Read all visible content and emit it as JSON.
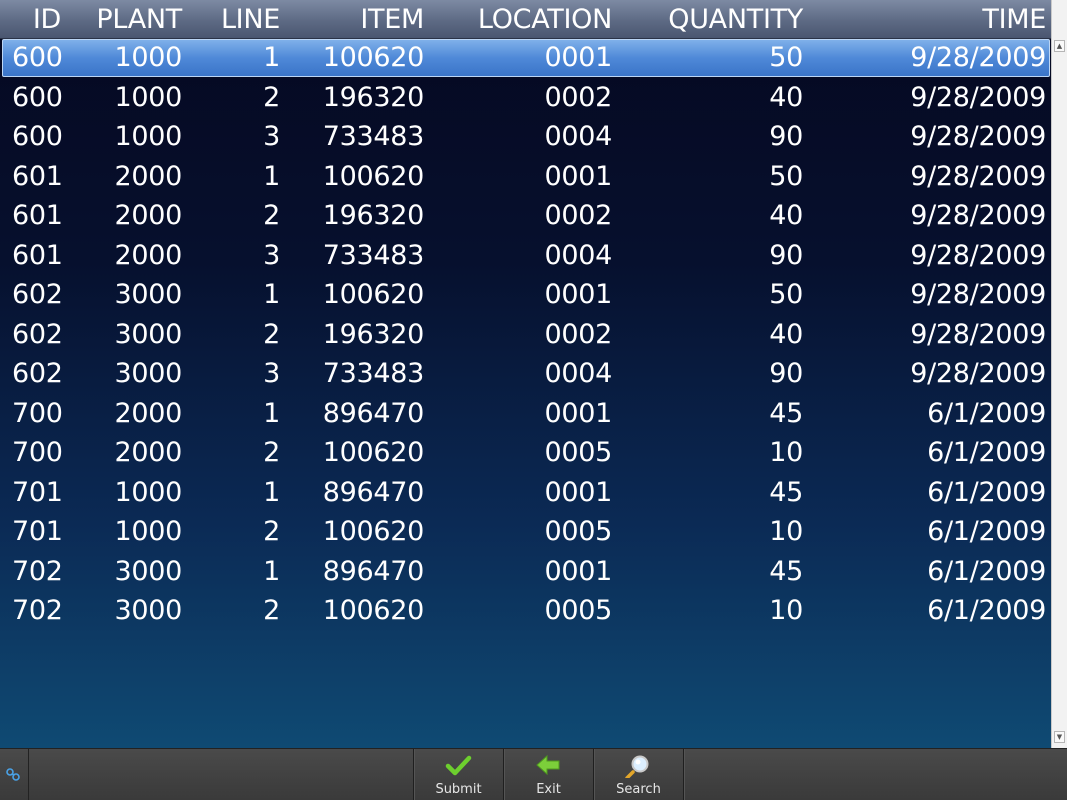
{
  "table": {
    "columns": [
      "ID",
      "PLANT",
      "LINE",
      "ITEM",
      "LOCATION",
      "QUANTITY",
      "TIME"
    ],
    "rows": [
      {
        "id": "600",
        "plant": "1000",
        "line": "1",
        "item": "100620",
        "location": "0001",
        "quantity": "50",
        "time": "9/28/2009",
        "selected": true
      },
      {
        "id": "600",
        "plant": "1000",
        "line": "2",
        "item": "196320",
        "location": "0002",
        "quantity": "40",
        "time": "9/28/2009"
      },
      {
        "id": "600",
        "plant": "1000",
        "line": "3",
        "item": "733483",
        "location": "0004",
        "quantity": "90",
        "time": "9/28/2009"
      },
      {
        "id": "601",
        "plant": "2000",
        "line": "1",
        "item": "100620",
        "location": "0001",
        "quantity": "50",
        "time": "9/28/2009"
      },
      {
        "id": "601",
        "plant": "2000",
        "line": "2",
        "item": "196320",
        "location": "0002",
        "quantity": "40",
        "time": "9/28/2009"
      },
      {
        "id": "601",
        "plant": "2000",
        "line": "3",
        "item": "733483",
        "location": "0004",
        "quantity": "90",
        "time": "9/28/2009"
      },
      {
        "id": "602",
        "plant": "3000",
        "line": "1",
        "item": "100620",
        "location": "0001",
        "quantity": "50",
        "time": "9/28/2009"
      },
      {
        "id": "602",
        "plant": "3000",
        "line": "2",
        "item": "196320",
        "location": "0002",
        "quantity": "40",
        "time": "9/28/2009"
      },
      {
        "id": "602",
        "plant": "3000",
        "line": "3",
        "item": "733483",
        "location": "0004",
        "quantity": "90",
        "time": "9/28/2009"
      },
      {
        "id": "700",
        "plant": "2000",
        "line": "1",
        "item": "896470",
        "location": "0001",
        "quantity": "45",
        "time": "6/1/2009"
      },
      {
        "id": "700",
        "plant": "2000",
        "line": "2",
        "item": "100620",
        "location": "0005",
        "quantity": "10",
        "time": "6/1/2009"
      },
      {
        "id": "701",
        "plant": "1000",
        "line": "1",
        "item": "896470",
        "location": "0001",
        "quantity": "45",
        "time": "6/1/2009"
      },
      {
        "id": "701",
        "plant": "1000",
        "line": "2",
        "item": "100620",
        "location": "0005",
        "quantity": "10",
        "time": "6/1/2009"
      },
      {
        "id": "702",
        "plant": "3000",
        "line": "1",
        "item": "896470",
        "location": "0001",
        "quantity": "45",
        "time": "6/1/2009"
      },
      {
        "id": "702",
        "plant": "3000",
        "line": "2",
        "item": "100620",
        "location": "0005",
        "quantity": "10",
        "time": "6/1/2009"
      }
    ]
  },
  "toolbar": {
    "link_icon": "link-icon",
    "buttons": [
      {
        "label": "Submit",
        "icon": "checkmark-icon",
        "color": "#5fbf2a"
      },
      {
        "label": "Exit",
        "icon": "arrow-left-icon",
        "color": "#6cc43a"
      },
      {
        "label": "Search",
        "icon": "magnifier-icon",
        "color": "#e8b33a"
      }
    ]
  },
  "colors": {
    "selection": "#4f89d8",
    "header": "#5d6a84",
    "text": "#ffffff"
  }
}
